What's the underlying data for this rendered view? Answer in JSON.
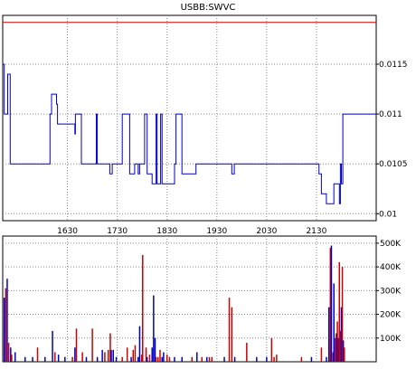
{
  "title": "USBB:SWVC",
  "colors": {
    "price": "#0000cc",
    "ref": "#cc0000",
    "vol_up": "#0000cc",
    "vol_down": "#cc0000",
    "grid": "#888888"
  },
  "chart_data": [
    {
      "type": "line",
      "name": "price",
      "x_ticks": [
        "1630",
        "1730",
        "1830",
        "1930",
        "2030",
        "2130"
      ],
      "y_ticks": [
        "0.01",
        "0.0105",
        "0.011",
        "0.0115"
      ],
      "ylim": [
        0.00993,
        0.01199
      ],
      "xlim": [
        1500,
        2250
      ],
      "grid": true,
      "reference_line": 0.01192,
      "x": [
        1500,
        1503,
        1508,
        1510,
        1513,
        1515,
        1518,
        1520,
        1523,
        1530,
        1560,
        1580,
        1595,
        1598,
        1600,
        1605,
        1608,
        1610,
        1613,
        1615,
        1618,
        1620,
        1625,
        1630,
        1645,
        1646,
        1655,
        1658,
        1660,
        1665,
        1670,
        1672,
        1675,
        1678,
        1680,
        1688,
        1690,
        1700,
        1710,
        1715,
        1720,
        1725,
        1740,
        1755,
        1760,
        1765,
        1770,
        1772,
        1775,
        1778,
        1780,
        1785,
        1790,
        1800,
        1808,
        1810,
        1815,
        1817,
        1820,
        1822,
        1825,
        1830,
        1835,
        1838,
        1840,
        1845,
        1848,
        1852,
        1855,
        1860,
        1880,
        1888,
        1889,
        1890,
        1895,
        1900,
        1930,
        1940,
        1945,
        1946,
        1950,
        1955,
        1960,
        1965,
        1970,
        1972,
        1975,
        1980,
        1990,
        2000,
        2130,
        2135,
        2140,
        2150,
        2160,
        2165,
        2168,
        2171,
        2174,
        2176,
        2178,
        2180,
        2183,
        2185,
        2190
      ],
      "y": [
        0.0115,
        0.011,
        0.011,
        0.0114,
        0.0114,
        0.0105,
        0.0105,
        0.0105,
        0.0105,
        0.0105,
        0.0105,
        0.0105,
        0.011,
        0.0112,
        0.0112,
        0.0112,
        0.0111,
        0.0109,
        0.0109,
        0.0109,
        0.0109,
        0.0109,
        0.0109,
        0.0109,
        0.0108,
        0.011,
        0.011,
        0.0105,
        0.0105,
        0.0105,
        0.0105,
        0.0105,
        0.0105,
        0.0105,
        0.0105,
        0.011,
        0.0105,
        0.0105,
        0.0105,
        0.0104,
        0.0105,
        0.0105,
        0.011,
        0.0104,
        0.0104,
        0.0105,
        0.0105,
        0.0104,
        0.0105,
        0.0105,
        0.0105,
        0.011,
        0.0104,
        0.0103,
        0.011,
        0.0103,
        0.0103,
        0.011,
        0.0103,
        0.0103,
        0.0103,
        0.0103,
        0.0103,
        0.0103,
        0.0103,
        0.0105,
        0.011,
        0.011,
        0.011,
        0.0104,
        0.0104,
        0.0105,
        0.0105,
        0.0105,
        0.0105,
        0.0105,
        0.0105,
        0.0105,
        0.0105,
        0.0105,
        0.0105,
        0.0105,
        0.0104,
        0.0105,
        0.0105,
        0.0105,
        0.0105,
        0.0105,
        0.0105,
        0.0105,
        0.0105,
        0.0104,
        0.0102,
        0.0101,
        0.0101,
        0.0103,
        0.0103,
        0.0103,
        0.0103,
        0.0101,
        0.0105,
        0.0103,
        0.011,
        0.011,
        0.011
      ]
    },
    {
      "type": "bar",
      "name": "volume",
      "y_ticks": [
        "100K",
        "200K",
        "300K",
        "400K",
        "500K"
      ],
      "ylim": [
        0,
        530000
      ],
      "xlim": [
        1500,
        2250
      ],
      "grid": true,
      "bars": [
        [
          1503,
          270000,
          "u"
        ],
        [
          1506,
          310000,
          "d"
        ],
        [
          1509,
          350000,
          "u"
        ],
        [
          1512,
          80000,
          "d"
        ],
        [
          1516,
          60000,
          "u"
        ],
        [
          1518,
          30000,
          "d"
        ],
        [
          1525,
          40000,
          "u"
        ],
        [
          1545,
          20000,
          "u"
        ],
        [
          1560,
          20000,
          "u"
        ],
        [
          1570,
          60000,
          "d"
        ],
        [
          1585,
          20000,
          "u"
        ],
        [
          1600,
          130000,
          "u"
        ],
        [
          1605,
          40000,
          "d"
        ],
        [
          1612,
          30000,
          "u"
        ],
        [
          1625,
          20000,
          "u"
        ],
        [
          1640,
          20000,
          "d"
        ],
        [
          1645,
          60000,
          "u"
        ],
        [
          1648,
          140000,
          "d"
        ],
        [
          1660,
          40000,
          "d"
        ],
        [
          1668,
          20000,
          "u"
        ],
        [
          1680,
          140000,
          "d"
        ],
        [
          1690,
          20000,
          "u"
        ],
        [
          1700,
          50000,
          "u"
        ],
        [
          1705,
          40000,
          "d"
        ],
        [
          1712,
          50000,
          "d"
        ],
        [
          1716,
          120000,
          "d"
        ],
        [
          1718,
          50000,
          "u"
        ],
        [
          1722,
          50000,
          "u"
        ],
        [
          1728,
          20000,
          "u"
        ],
        [
          1740,
          20000,
          "d"
        ],
        [
          1750,
          60000,
          "d"
        ],
        [
          1758,
          20000,
          "u"
        ],
        [
          1762,
          50000,
          "d"
        ],
        [
          1766,
          70000,
          "d"
        ],
        [
          1772,
          20000,
          "u"
        ],
        [
          1775,
          150000,
          "u"
        ],
        [
          1779,
          30000,
          "d"
        ],
        [
          1781,
          450000,
          "d"
        ],
        [
          1788,
          60000,
          "d"
        ],
        [
          1790,
          20000,
          "u"
        ],
        [
          1795,
          30000,
          "d"
        ],
        [
          1800,
          60000,
          "u"
        ],
        [
          1803,
          280000,
          "u"
        ],
        [
          1806,
          100000,
          "u"
        ],
        [
          1808,
          20000,
          "d"
        ],
        [
          1812,
          20000,
          "d"
        ],
        [
          1816,
          50000,
          "d"
        ],
        [
          1820,
          20000,
          "u"
        ],
        [
          1823,
          40000,
          "u"
        ],
        [
          1830,
          30000,
          "d"
        ],
        [
          1835,
          20000,
          "d"
        ],
        [
          1845,
          20000,
          "u"
        ],
        [
          1860,
          20000,
          "u"
        ],
        [
          1880,
          20000,
          "d"
        ],
        [
          1890,
          40000,
          "u"
        ],
        [
          1900,
          20000,
          "d"
        ],
        [
          1910,
          20000,
          "u"
        ],
        [
          1915,
          20000,
          "d"
        ],
        [
          1920,
          20000,
          "d"
        ],
        [
          1945,
          20000,
          "u"
        ],
        [
          1955,
          270000,
          "d"
        ],
        [
          1960,
          230000,
          "d"
        ],
        [
          1966,
          20000,
          "u"
        ],
        [
          1990,
          80000,
          "d"
        ],
        [
          2010,
          20000,
          "u"
        ],
        [
          2030,
          20000,
          "u"
        ],
        [
          2040,
          100000,
          "d"
        ],
        [
          2045,
          20000,
          "d"
        ],
        [
          2050,
          30000,
          "d"
        ],
        [
          2100,
          20000,
          "d"
        ],
        [
          2120,
          20000,
          "u"
        ],
        [
          2140,
          60000,
          "d"
        ],
        [
          2150,
          20000,
          "u"
        ],
        [
          2155,
          230000,
          "u"
        ],
        [
          2158,
          480000,
          "d"
        ],
        [
          2160,
          490000,
          "u"
        ],
        [
          2163,
          40000,
          "d"
        ],
        [
          2165,
          330000,
          "u"
        ],
        [
          2168,
          100000,
          "d"
        ],
        [
          2170,
          120000,
          "u"
        ],
        [
          2172,
          170000,
          "d"
        ],
        [
          2174,
          100000,
          "u"
        ],
        [
          2176,
          420000,
          "d"
        ],
        [
          2178,
          130000,
          "d"
        ],
        [
          2180,
          230000,
          "u"
        ],
        [
          2182,
          400000,
          "d"
        ],
        [
          2184,
          90000,
          "u"
        ],
        [
          2186,
          60000,
          "d"
        ]
      ]
    }
  ]
}
